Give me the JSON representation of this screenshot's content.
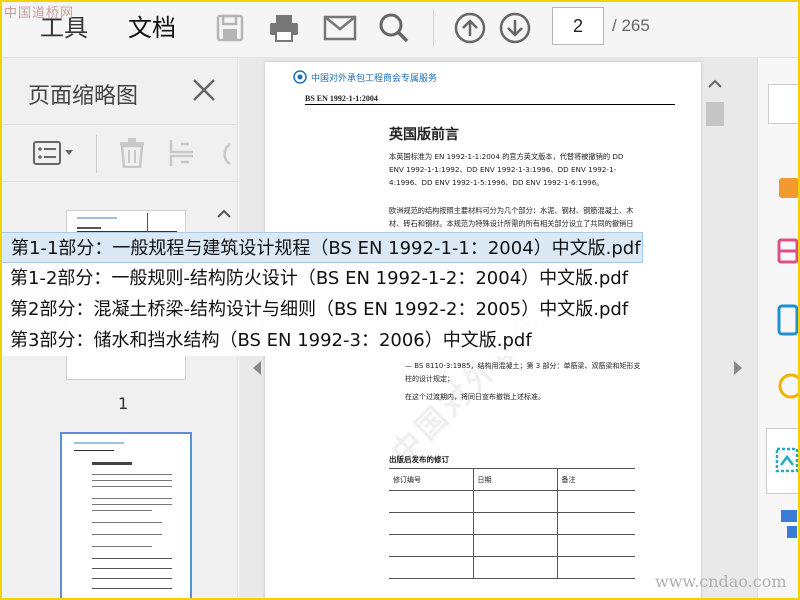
{
  "watermarks": {
    "top": "中国道桥网",
    "bottom": "www.cndao.com"
  },
  "toolbar": {
    "tabs": [
      {
        "label": "工具"
      },
      {
        "label": "文档"
      }
    ],
    "page_current": "2",
    "page_total": "/ 265"
  },
  "sidebar": {
    "title": "页面缩略图",
    "thumb_page_number": "1"
  },
  "document": {
    "header": "中国对外承包工程商会专属服务",
    "standard": "BS EN 1992-1-1:2004",
    "title": "英国版前言",
    "para1": "本英国标准为 EN 1992-1-1:2004 的官方英文版本，代替将被撤销的 DD ENV 1992-1-1:1992、DD ENV 1992-1-3:1996、DD ENV 1992-1-4:1996、DD ENV 1992-1-5:1996、DD ENV 1992-1-6:1996。",
    "para2": "欧洲规范的结构按照主要材料可分为几个部分：水泥、钢材、钢筋混凝土、木材、砖石和钢材。本规范为特殊设计所需的所有相关部分设立了共同的撤销日期（DOW），与此有冲突的国家标准将在共存期结束后撤销，即在本欧洲规范的全部内容公布之后撤销。",
    "list_item": "— BS 8110-3:1985，结构用混凝土；第 3 部分：单筋梁、双筋梁和矩形支柱的设计规定；",
    "note": "在这个过渡期内，将同日宣布撤销上述标准。",
    "amendments_heading": "出版后发布的修订",
    "table_headers": [
      "修订编号",
      "日期",
      "备注"
    ],
    "table_rows": 4
  },
  "file_list": [
    {
      "label": "第1-1部分：一般规程与建筑设计规程（BS EN 1992-1-1：2004）中文版.pdf",
      "selected": true
    },
    {
      "label": "第1-2部分：一般规则-结构防火设计（BS EN 1992-1-2：2004）中文版.pdf",
      "selected": false
    },
    {
      "label": "第2部分：混凝土桥梁-结构设计与细则（BS EN 1992-2：2005）中文版.pdf",
      "selected": false
    },
    {
      "label": "第3部分：储水和挡水结构（BS EN 1992-3：2006）中文版.pdf",
      "selected": false
    }
  ],
  "colors": {
    "frame": "#f2d200",
    "selection": "#dbe9f7",
    "accent_blue": "#1e6fb8"
  }
}
